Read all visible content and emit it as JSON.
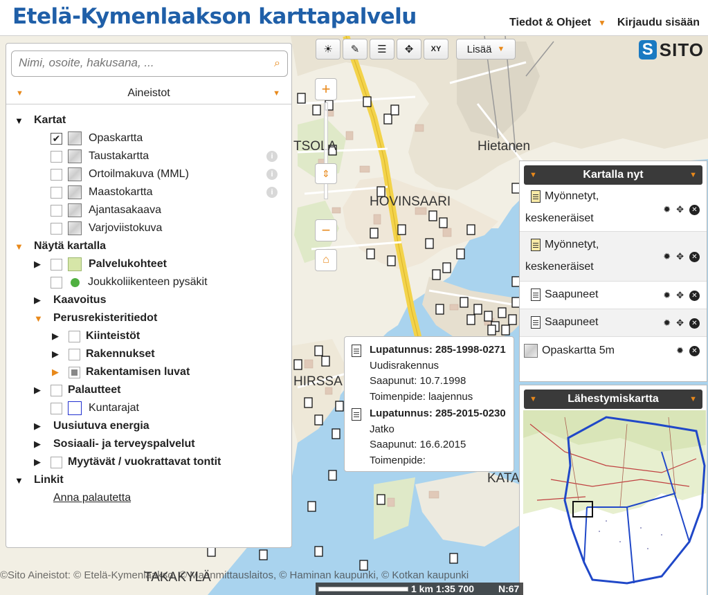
{
  "app": {
    "title": "Etelä-Kymenlaakson karttapalvelu",
    "links": [
      "Tiedot & Ohjeet",
      "Kirjaudu sisään"
    ]
  },
  "toolbar": {
    "tools": [
      "sun-icon",
      "ruler-icon",
      "list-icon",
      "move-icon",
      "xy-icon"
    ],
    "tool_glyphs": [
      "☀",
      "✎",
      "☰",
      "✥",
      "XY"
    ],
    "more_label": "Lisää"
  },
  "logo": {
    "text": "SITO",
    "mark": "S"
  },
  "left_panel": {
    "search_placeholder": "Nimi, osoite, hakusana, ...",
    "datasets_title": "Aineistot",
    "groups": {
      "maps": "Kartat",
      "show_on_map": "Näytä kartalla",
      "links": "Linkit"
    },
    "map_layers": [
      {
        "label": "Opaskartta",
        "checked": true
      },
      {
        "label": "Taustakartta",
        "checked": false
      },
      {
        "label": "Ortoilmakuva (MML)",
        "checked": false
      },
      {
        "label": "Maastokartta",
        "checked": false
      },
      {
        "label": "Ajantasakaava",
        "checked": false
      },
      {
        "label": "Varjoviistokuva",
        "checked": false
      }
    ],
    "overlay_items": {
      "palvelukohteet": "Palvelukohteet",
      "joukkoliikenne": "Joukkoliikenteen pysäkit",
      "kaavoitus": "Kaavoitus",
      "perusrekisteri": "Perusrekisteritiedot",
      "kiinteistot": "Kiinteistöt",
      "rakennukset": "Rakennukset",
      "rakentamisen_luvat": "Rakentamisen luvat",
      "palautteet": "Palautteet",
      "kuntarajat": "Kuntarajat",
      "uusiutuva": "Uusiutuva energia",
      "sosiaali": "Sosiaali- ja terveyspalvelut",
      "myytavat": "Myytävät / vuokrattavat tontit"
    },
    "feedback_link": "Anna palautetta"
  },
  "map": {
    "place_labels": [
      "TSOLA",
      "Hietanen",
      "HOVINSAARI",
      "HIRSSA",
      "KATA",
      "TAKAKYLÄ"
    ]
  },
  "kartalla_nyt": {
    "title": "Kartalla nyt",
    "items": [
      {
        "label": "Myönnetyt,",
        "label2": "keskeneräiset",
        "bold": false
      },
      {
        "label": "Myönnetyt,",
        "label2": "keskeneräiset",
        "bold": false
      },
      {
        "label": "Saapuneet",
        "bold": false
      },
      {
        "label": "Saapuneet",
        "bold": false
      },
      {
        "label": "Opaskartta 5m",
        "bold": false
      }
    ]
  },
  "lahestymiskartta": {
    "title": "Lähestymiskartta"
  },
  "popup": {
    "entries": [
      {
        "title": "Lupatunnus: 285-1998-0271",
        "line1": "Uudisrakennus",
        "line2": "Saapunut: 10.7.1998",
        "line3": "Toimenpide: laajennus"
      },
      {
        "title": "Lupatunnus: 285-2015-0230",
        "line1": "Jatko",
        "line2": "Saapunut: 16.6.2015",
        "line3": "Toimenpide:"
      }
    ]
  },
  "attribution": "©Sito Aineistot: © Etelä-Kymenlaakso, © Maanmittauslaitos, © Haminan kaupunki, © Kotkan kaupunki",
  "scale": {
    "distance": "1 km",
    "ratio": "1:35 700",
    "coord": "N:67"
  }
}
